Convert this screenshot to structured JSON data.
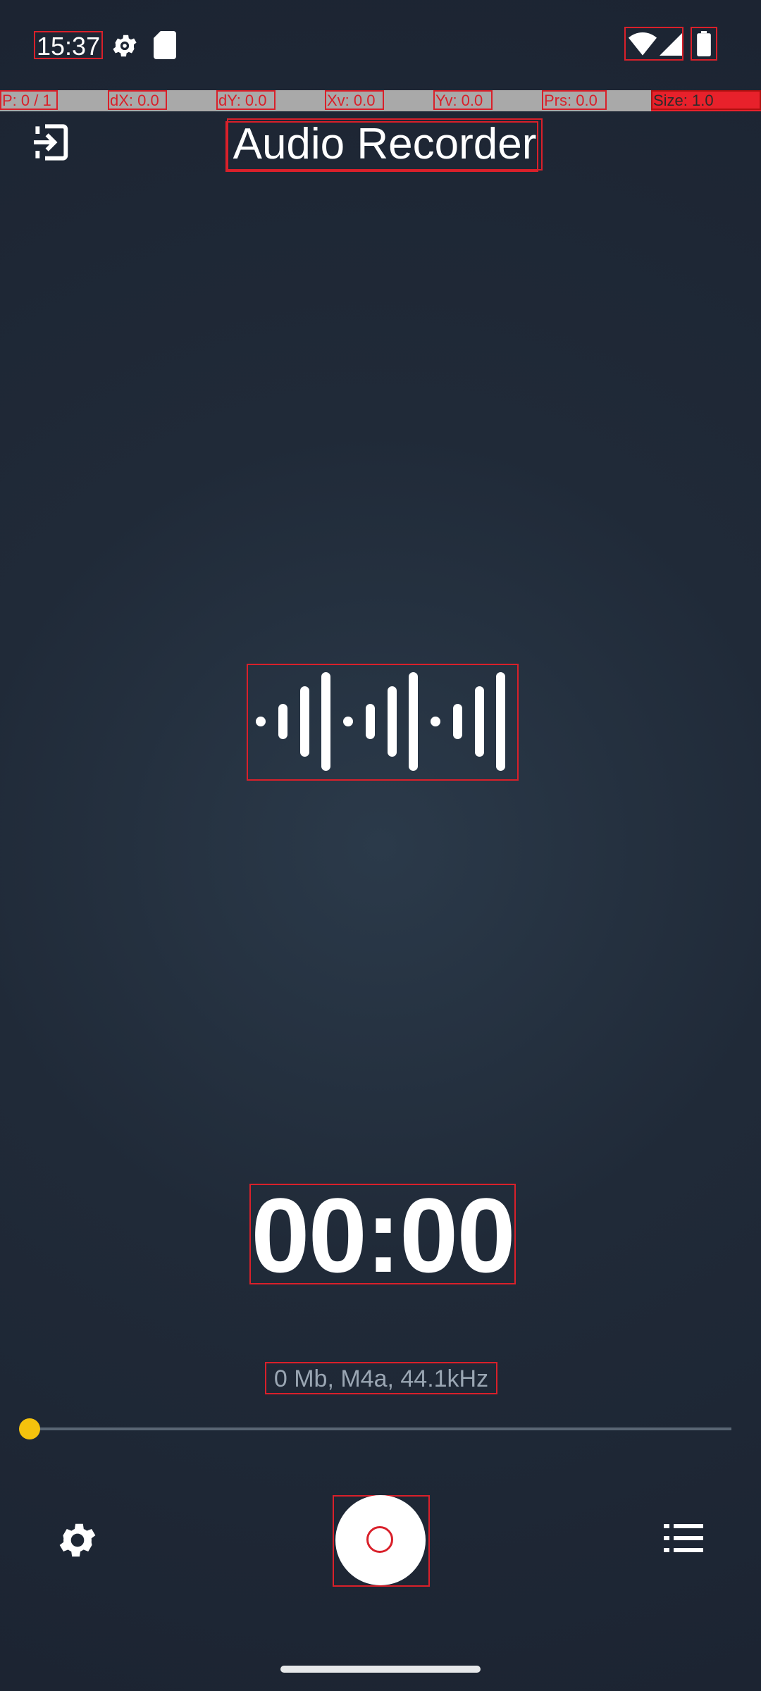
{
  "status_bar": {
    "time": "15:37",
    "icons": [
      "gear-icon",
      "sd-card-icon",
      "wifi-icon",
      "signal-icon",
      "battery-icon"
    ]
  },
  "pointer_overlay": {
    "p": "P: 0 / 1",
    "dx": "dX: 0.0",
    "dy": "dY: 0.0",
    "xv": "Xv: 0.0",
    "yv": "Yv: 0.0",
    "prs": "Prs: 0.0",
    "size": "Size: 1.0"
  },
  "header": {
    "title": "Audio Recorder",
    "exit_icon": "exit-icon"
  },
  "recorder": {
    "waveform_icon": "waveform-icon",
    "timer": "00:00",
    "info": "0 Mb, M4a, 44.1kHz",
    "progress": 0
  },
  "controls": {
    "settings_icon": "gear-icon",
    "record_icon": "record-icon",
    "list_icon": "list-icon"
  },
  "colors": {
    "accent": "#f4c20d",
    "record": "#d9202a",
    "background": "#202a38"
  }
}
